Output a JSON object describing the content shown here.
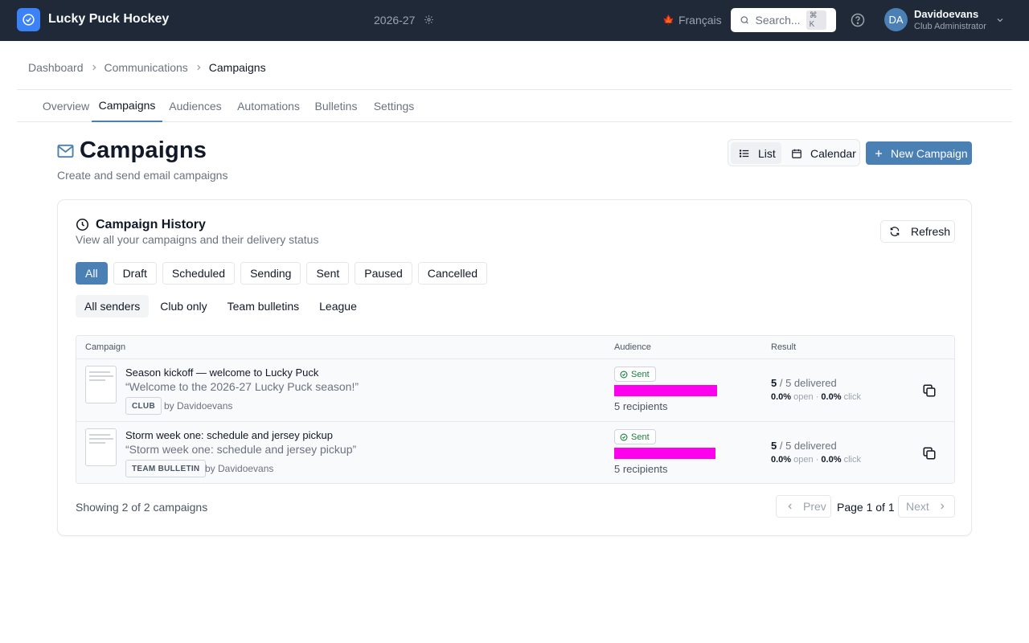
{
  "app": {
    "title": "Lucky Puck Hockey",
    "season": "2026-27"
  },
  "header": {
    "language": "Français",
    "search_label": "Search...",
    "search_shortcut": "⌘ K",
    "user": {
      "initials": "DA",
      "name": "Davidoevans",
      "role": "Club Administrator"
    }
  },
  "breadcrumb": {
    "items": [
      "Dashboard",
      "Communications"
    ],
    "current": "Campaigns"
  },
  "tabs": [
    "Overview",
    "Campaigns",
    "Audiences",
    "Automations",
    "Bulletins",
    "Settings"
  ],
  "active_tab": "Campaigns",
  "page": {
    "title": "Campaigns",
    "subtitle": "Create and send email campaigns",
    "view_list": "List",
    "view_calendar": "Calendar",
    "new_button": "New Campaign"
  },
  "card": {
    "title": "Campaign History",
    "subtitle": "View all your campaigns and their delivery status",
    "refresh": "Refresh",
    "status_filters": [
      "All",
      "Draft",
      "Scheduled",
      "Sending",
      "Sent",
      "Paused",
      "Cancelled"
    ],
    "sender_filters": [
      "All senders",
      "Club only",
      "Team bulletins",
      "League"
    ]
  },
  "table": {
    "headers": {
      "campaign": "Campaign",
      "audience": "Audience",
      "result": "Result"
    },
    "rows": [
      {
        "name": "Season kickoff — welcome to Lucky Puck",
        "quote": "“Welcome to the 2026-27 Lucky Puck season!”",
        "tag": "CLUB",
        "by": "by Davidoevans",
        "status": "Sent",
        "delivery_fraction": 1.0,
        "recipients": "5 recipients",
        "delivered_count": "5",
        "delivered_total": "/ 5 delivered",
        "open_rate": "0.0%",
        "open_label": "open",
        "click_rate": "0.0%",
        "click_label": "click"
      },
      {
        "name": "Storm week one: schedule and jersey pickup",
        "quote": "“Storm week one: schedule and jersey pickup”",
        "tag": "TEAM BULLETIN",
        "by": "by Davidoevans",
        "status": "Sent",
        "delivery_fraction": 1.0,
        "recipients": "5 recipients",
        "delivered_count": "5",
        "delivered_total": "/ 5 delivered",
        "open_rate": "0.0%",
        "open_label": "open",
        "click_rate": "0.0%",
        "click_label": "click"
      }
    ]
  },
  "footer": {
    "showing": "Showing 2 of 2 campaigns",
    "prev": "Prev",
    "page_label": "Page 1 of 1",
    "next": "Next"
  },
  "colors": {
    "topbar": "#1f2937",
    "accent": "#4a80b4",
    "sent_green": "#15803d",
    "progress": "#ff00ee"
  }
}
